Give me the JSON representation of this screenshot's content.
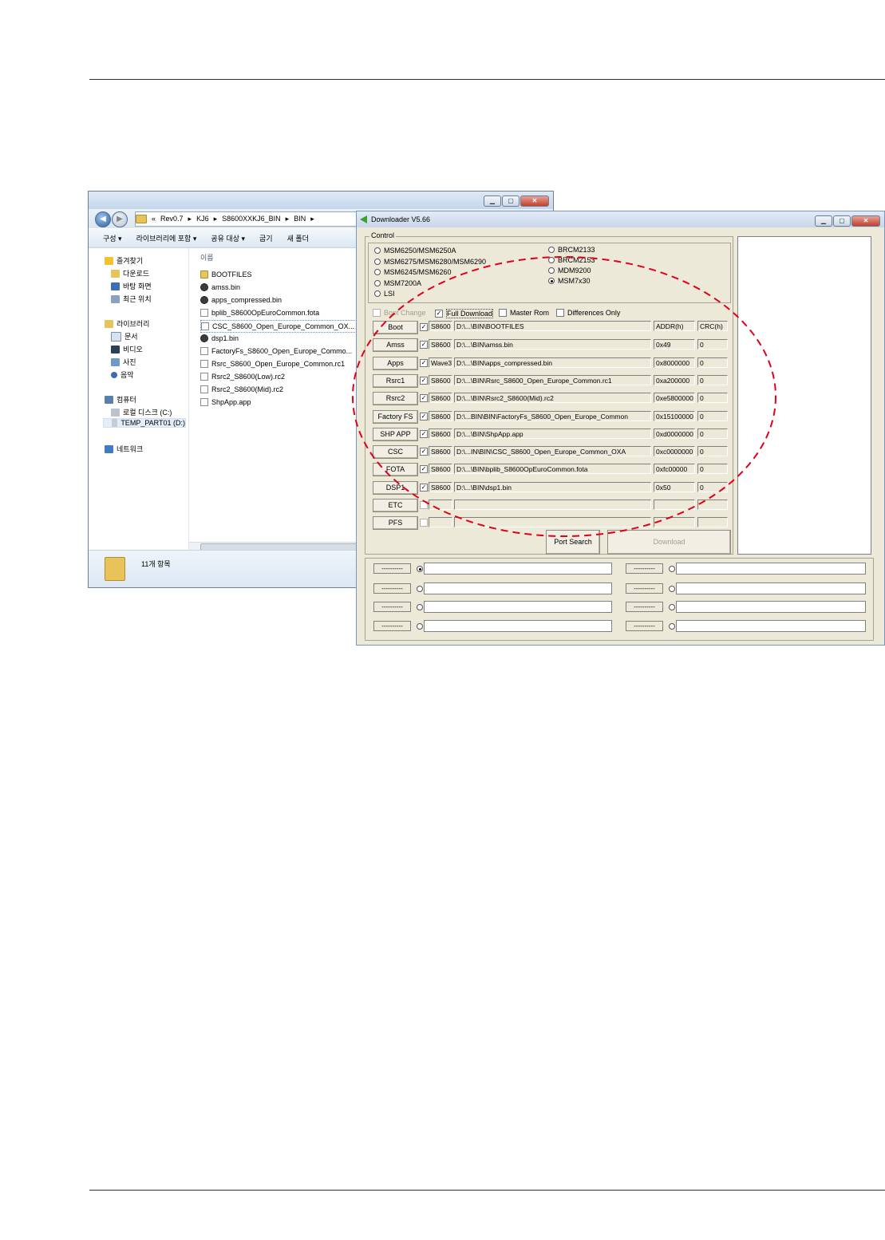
{
  "explorer": {
    "address": [
      "«",
      "Rev0.7",
      "▸",
      "KJ6",
      "▸",
      "S8600XXKJ6_BIN",
      "▸",
      "BIN",
      "▸"
    ],
    "toolbar": [
      "구성 ▾",
      "라이브러리에 포함 ▾",
      "공유 대상 ▾",
      "굽기",
      "새 폴더"
    ],
    "nav": {
      "favorites": "즐겨찾기",
      "downloads": "다운로드",
      "desktop": "바탕 화면",
      "recent": "최근 위치",
      "libraries": "라이브러리",
      "documents": "문서",
      "videos": "비디오",
      "pictures": "사진",
      "music": "음악",
      "computer": "컴퓨터",
      "local_disk": "로컬 디스크 (C:)",
      "temp_part": "TEMP_PART01 (D:)",
      "network": "네트워크"
    },
    "column_header": "이름",
    "files": [
      "BOOTFILES",
      "amss.bin",
      "apps_compressed.bin",
      "bplib_S8600OpEuroCommon.fota",
      "CSC_S8600_Open_Europe_Common_OX...",
      "dsp1.bin",
      "FactoryFs_S8600_Open_Europe_Commo...",
      "Rsrc_S8600_Open_Europe_Common.rc1",
      "Rsrc2_S8600(Low).rc2",
      "Rsrc2_S8600(Mid).rc2",
      "ShpApp.app"
    ],
    "status": "11개 항목"
  },
  "downloader": {
    "title": "Downloader V5.66",
    "control_label": "Control",
    "chipsets_left": [
      "MSM6250/MSM6250A",
      "MSM6275/MSM6280/MSM6290",
      "MSM6245/MSM6260",
      "MSM7200A",
      "LSI"
    ],
    "chipsets_right": [
      "BRCM2133",
      "BRCM2153",
      "MDM9200",
      "MSM7x30"
    ],
    "selected_chipset": "MSM7x30",
    "options": {
      "boot_change": "Boot Change",
      "full_download": "Full Download",
      "master_rom": "Master Rom",
      "differences_only": "Differences Only"
    },
    "header_addr": "ADDR(h)",
    "header_crc": "CRC(h)",
    "rows": [
      {
        "button": "Boot",
        "checked": true,
        "model": "S8600",
        "path": "D:\\...\\BIN\\BOOTFILES",
        "addr": "",
        "crc": ""
      },
      {
        "button": "Amss",
        "checked": true,
        "model": "S8600",
        "path": "D:\\...\\BIN\\amss.bin",
        "addr": "0x49",
        "crc": "0"
      },
      {
        "button": "Apps",
        "checked": true,
        "model": "Wave3",
        "path": "D:\\...\\BIN\\apps_compressed.bin",
        "addr": "0x8000000",
        "crc": "0"
      },
      {
        "button": "Rsrc1",
        "checked": true,
        "model": "S8600",
        "path": "D:\\...\\BIN\\Rsrc_S8600_Open_Europe_Common.rc1",
        "addr": "0xa200000",
        "crc": "0"
      },
      {
        "button": "Rsrc2",
        "checked": true,
        "model": "S8600",
        "path": "D:\\...\\BIN\\Rsrc2_S8600(Mid).rc2",
        "addr": "0xe5800000",
        "crc": "0"
      },
      {
        "button": "Factory FS",
        "checked": true,
        "model": "S8600",
        "path": "D:\\...BIN\\BIN\\FactoryFs_S8600_Open_Europe_Common",
        "addr": "0x15100000",
        "crc": "0"
      },
      {
        "button": "SHP APP",
        "checked": true,
        "model": "S8600",
        "path": "D:\\...\\BIN\\ShpApp.app",
        "addr": "0xd0000000",
        "crc": "0"
      },
      {
        "button": "CSC",
        "checked": true,
        "model": "S8600",
        "path": "D:\\...IN\\BIN\\CSC_S8600_Open_Europe_Common_OXA",
        "addr": "0xc0000000",
        "crc": "0"
      },
      {
        "button": "FOTA",
        "checked": true,
        "model": "S8600",
        "path": "D:\\...\\BIN\\bplib_S8600OpEuroCommon.fota",
        "addr": "0xfc00000",
        "crc": "0"
      },
      {
        "button": "DSP1",
        "checked": true,
        "model": "S8600",
        "path": "D:\\...\\BIN\\dsp1.bin",
        "addr": "0x50",
        "crc": "0"
      },
      {
        "button": "ETC",
        "checked": false,
        "model": "",
        "path": "",
        "addr": "",
        "crc": ""
      },
      {
        "button": "PFS",
        "checked": false,
        "model": "",
        "path": "",
        "addr": "",
        "crc": ""
      }
    ],
    "port_search": "Port Search",
    "download": "Download",
    "port_placeholder": "----------"
  },
  "colors": {
    "highlight_ellipse": "#e0001a",
    "window_face": "#ece9d8",
    "title_gradient_top": "#e3ebf6"
  }
}
